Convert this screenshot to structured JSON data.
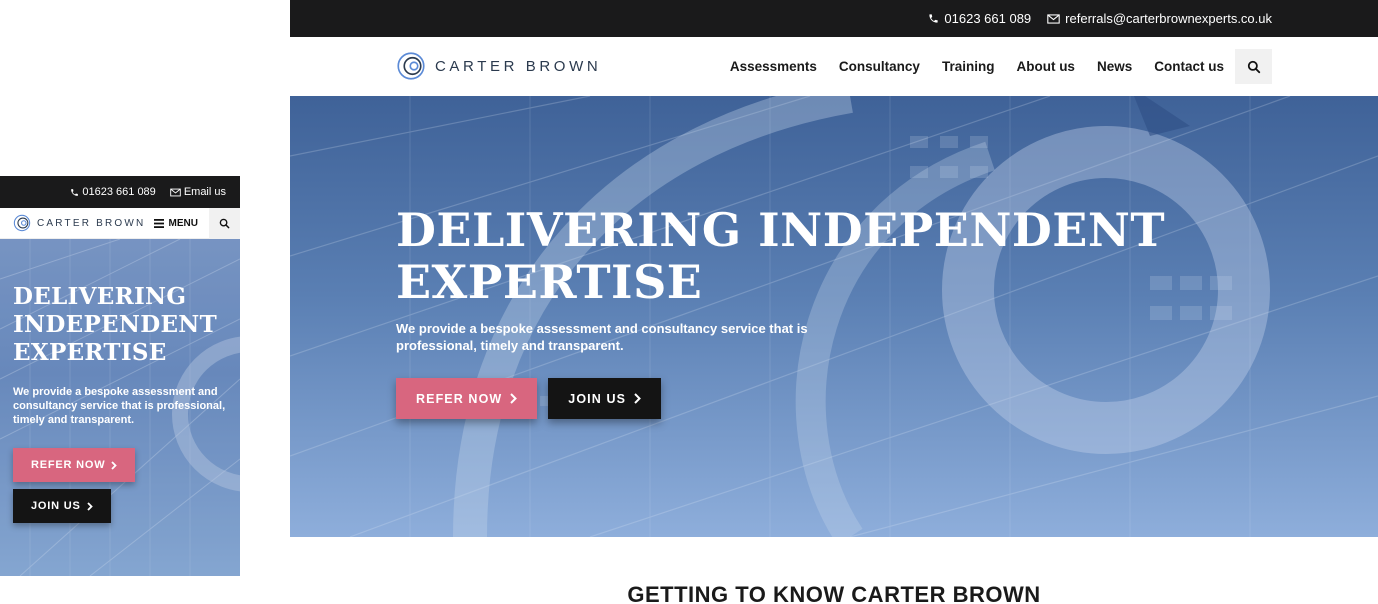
{
  "brand": {
    "name": "CARTER BROWN",
    "accent_pink": "#d8667f",
    "dark": "#1a1a1b"
  },
  "mobile": {
    "topbar": {
      "phone": "01623 661 089",
      "email": "Email us"
    },
    "menu_label": "MENU",
    "hero": {
      "title": "DELIVERING INDEPENDENT EXPERTISE",
      "subtitle": "We provide a bespoke assessment and consultancy service that is professional, timely and transparent.",
      "refer_label": "REFER NOW",
      "join_label": "JOIN US"
    }
  },
  "desktop": {
    "topbar": {
      "phone": "01623 661 089",
      "email": "referrals@carterbrownexperts.co.uk"
    },
    "nav": {
      "items": [
        "Assessments",
        "Consultancy",
        "Training",
        "About us",
        "News",
        "Contact us"
      ]
    },
    "hero": {
      "title_line1": "DELIVERING INDEPENDENT",
      "title_line2": "EXPERTISE",
      "subtitle": "We provide a bespoke assessment and consultancy service that is professional, timely and transparent.",
      "refer_label": "REFER NOW",
      "join_label": "JOIN US"
    },
    "section_title": "GETTING TO KNOW CARTER BROWN"
  },
  "icons": {
    "phone": "phone-icon",
    "email": "envelope-icon",
    "search": "search-icon",
    "menu": "hamburger-icon",
    "chevron": "chevron-right-icon",
    "logo": "carter-brown-logo-icon"
  }
}
